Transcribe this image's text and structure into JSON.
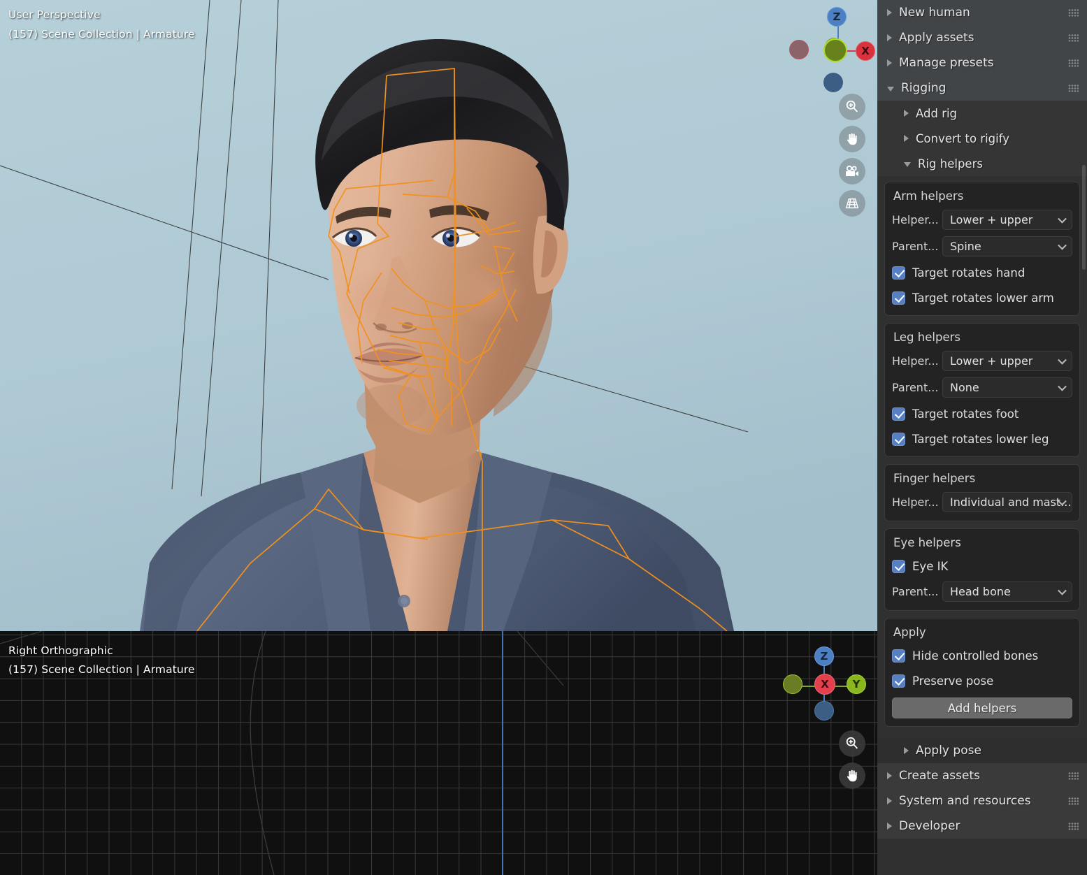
{
  "viewport_top": {
    "name": "3d-viewport-perspective",
    "line1": "User Perspective",
    "line2": "(157) Scene Collection | Armature",
    "background_color": "#b0cbd6",
    "gizmo": {
      "z": "Z",
      "y": "Y",
      "x": "X"
    },
    "nav_buttons": [
      "zoom-icon",
      "pan-hand-icon",
      "camera-icon",
      "grid-perspective-icon"
    ]
  },
  "viewport_bottom": {
    "name": "3d-viewport-orthographic",
    "line1": "Right Orthographic",
    "line2": "(157) Scene Collection | Armature",
    "background_color": "#101010",
    "grid_color": "#3a3a3a",
    "axis_color": "#4772b3",
    "gizmo": {
      "z": "Z",
      "x": "X",
      "y": "Y"
    },
    "nav_buttons": [
      "zoom-icon",
      "pan-hand-icon"
    ]
  },
  "sidebar": {
    "top_panels": [
      {
        "label": "New human",
        "expanded": false
      },
      {
        "label": "Apply assets",
        "expanded": false
      },
      {
        "label": "Manage presets",
        "expanded": false
      },
      {
        "label": "Rigging",
        "expanded": true
      }
    ],
    "rigging_subpanels": [
      {
        "label": "Add rig",
        "expanded": false
      },
      {
        "label": "Convert to rigify",
        "expanded": false
      },
      {
        "label": "Rig helpers",
        "expanded": true
      }
    ],
    "arm_helpers": {
      "title": "Arm helpers",
      "helper_label": "Helper...",
      "helper_value": "Lower + upper",
      "parent_label": "Parent...",
      "parent_value": "Spine",
      "checkboxes": [
        {
          "label": "Target rotates hand",
          "checked": true
        },
        {
          "label": "Target rotates lower arm",
          "checked": true
        }
      ]
    },
    "leg_helpers": {
      "title": "Leg helpers",
      "helper_label": "Helper...",
      "helper_value": "Lower + upper",
      "parent_label": "Parent...",
      "parent_value": "None",
      "checkboxes": [
        {
          "label": "Target rotates foot",
          "checked": true
        },
        {
          "label": "Target rotates lower leg",
          "checked": true
        }
      ]
    },
    "finger_helpers": {
      "title": "Finger helpers",
      "helper_label": "Helper...",
      "helper_value": "Individual and mast..."
    },
    "eye_helpers": {
      "title": "Eye helpers",
      "checkbox": {
        "label": "Eye IK",
        "checked": true
      },
      "parent_label": "Parent...",
      "parent_value": "Head bone"
    },
    "apply": {
      "title": "Apply",
      "checkboxes": [
        {
          "label": "Hide controlled bones",
          "checked": true
        },
        {
          "label": "Preserve pose",
          "checked": true
        }
      ],
      "button_label": "Add helpers"
    },
    "apply_pose": {
      "label": "Apply pose",
      "expanded": false
    },
    "bottom_panels": [
      {
        "label": "Create assets",
        "expanded": false
      },
      {
        "label": "System and resources",
        "expanded": false
      },
      {
        "label": "Developer",
        "expanded": false
      }
    ],
    "accent_checkbox_color": "#5680c2",
    "panel_header_color": "#424548",
    "background_color": "#303030"
  }
}
